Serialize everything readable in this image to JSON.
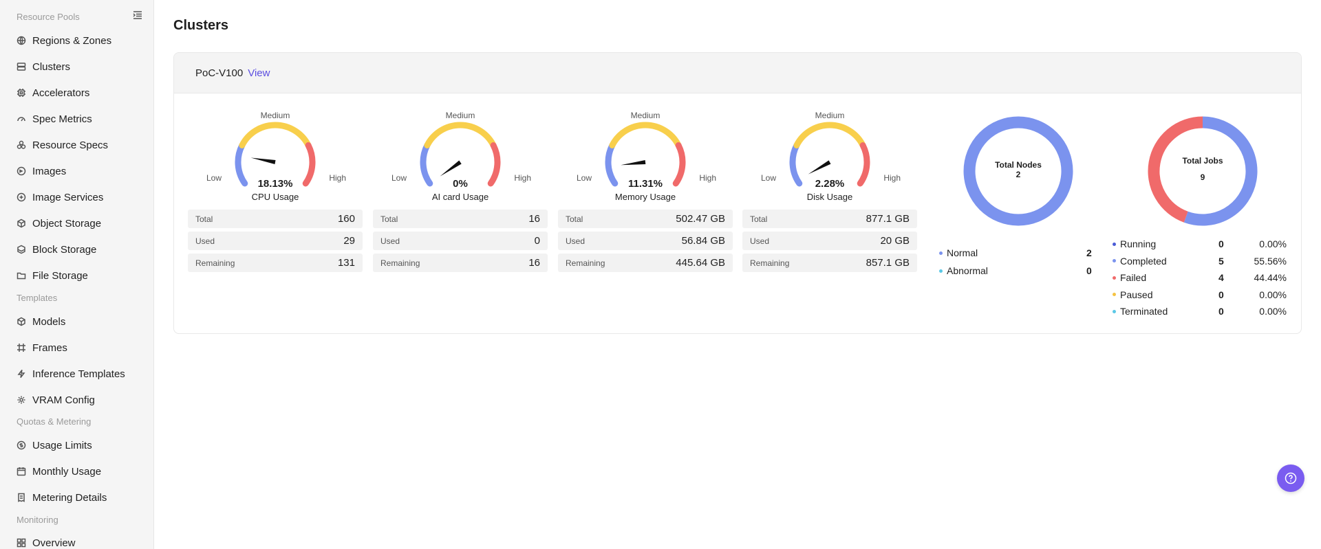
{
  "sidebar": {
    "sections": [
      {
        "title": "Resource Pools"
      },
      {
        "title": "Templates"
      },
      {
        "title": "Quotas & Metering"
      },
      {
        "title": "Monitoring"
      }
    ],
    "items": [
      {
        "label": "Regions & Zones",
        "icon": "globe-icon"
      },
      {
        "label": "Clusters",
        "icon": "server-icon"
      },
      {
        "label": "Accelerators",
        "icon": "chip-icon"
      },
      {
        "label": "Spec Metrics",
        "icon": "gauge-icon"
      },
      {
        "label": "Resource Specs",
        "icon": "stack-icon"
      },
      {
        "label": "Images",
        "icon": "disc-icon"
      },
      {
        "label": "Image Services",
        "icon": "disc-plus-icon"
      },
      {
        "label": "Object Storage",
        "icon": "cube-icon"
      },
      {
        "label": "Block Storage",
        "icon": "database-icon"
      },
      {
        "label": "File Storage",
        "icon": "folder-icon"
      },
      {
        "label": "Models",
        "icon": "cube-icon"
      },
      {
        "label": "Frames",
        "icon": "frame-icon"
      },
      {
        "label": "Inference Templates",
        "icon": "bolt-icon"
      },
      {
        "label": "VRAM Config",
        "icon": "gear-icon"
      },
      {
        "label": "Usage Limits",
        "icon": "coin-icon"
      },
      {
        "label": "Monthly Usage",
        "icon": "calendar-icon"
      },
      {
        "label": "Metering Details",
        "icon": "receipt-icon"
      },
      {
        "label": "Overview",
        "icon": "grid-icon"
      }
    ]
  },
  "page": {
    "title": "Clusters"
  },
  "cluster": {
    "name": "PoC-V100",
    "view_label": "View",
    "gauges": [
      {
        "name": "CPU Usage",
        "pct_text": "18.13%",
        "pct": 18.13,
        "medium": "Medium",
        "low": "Low",
        "high": "High",
        "rows": [
          {
            "label": "Total",
            "value": "160"
          },
          {
            "label": "Used",
            "value": "29"
          },
          {
            "label": "Remaining",
            "value": "131"
          }
        ]
      },
      {
        "name": "AI card Usage",
        "pct_text": "0%",
        "pct": 0,
        "medium": "Medium",
        "low": "Low",
        "high": "High",
        "rows": [
          {
            "label": "Total",
            "value": "16"
          },
          {
            "label": "Used",
            "value": "0"
          },
          {
            "label": "Remaining",
            "value": "16"
          }
        ]
      },
      {
        "name": "Memory Usage",
        "pct_text": "11.31%",
        "pct": 11.31,
        "medium": "Medium",
        "low": "Low",
        "high": "High",
        "rows": [
          {
            "label": "Total",
            "value": "502.47 GB"
          },
          {
            "label": "Used",
            "value": "56.84 GB"
          },
          {
            "label": "Remaining",
            "value": "445.64 GB"
          }
        ]
      },
      {
        "name": "Disk Usage",
        "pct_text": "2.28%",
        "pct": 2.28,
        "medium": "Medium",
        "low": "Low",
        "high": "High",
        "rows": [
          {
            "label": "Total",
            "value": "877.1 GB"
          },
          {
            "label": "Used",
            "value": "20 GB"
          },
          {
            "label": "Remaining",
            "value": "857.1 GB"
          }
        ]
      }
    ],
    "nodes": {
      "title": "Total Nodes",
      "total": "2",
      "legend": [
        {
          "label": "Normal",
          "count": "2",
          "color": "#7b93ee",
          "value": 2
        },
        {
          "label": "Abnormal",
          "count": "0",
          "color": "#5bc8e6",
          "value": 0
        }
      ]
    },
    "jobs": {
      "title": "Total Jobs",
      "total": "9",
      "legend": [
        {
          "label": "Running",
          "count": "0",
          "pct": "0.00%",
          "color": "#4a5bd6",
          "value": 0
        },
        {
          "label": "Completed",
          "count": "5",
          "pct": "55.56%",
          "color": "#7b93ee",
          "value": 5
        },
        {
          "label": "Failed",
          "count": "4",
          "pct": "44.44%",
          "color": "#f06a6a",
          "value": 4
        },
        {
          "label": "Paused",
          "count": "0",
          "pct": "0.00%",
          "color": "#f5c342",
          "value": 0
        },
        {
          "label": "Terminated",
          "count": "0",
          "pct": "0.00%",
          "color": "#5bc8e6",
          "value": 0
        }
      ]
    }
  },
  "colors": {
    "low": "#7b93ee",
    "medium": "#f8cf4c",
    "high": "#f06a6a",
    "accent": "#5b4ee0",
    "help": "#7a5cf0"
  },
  "help": {
    "icon": "help-icon"
  }
}
